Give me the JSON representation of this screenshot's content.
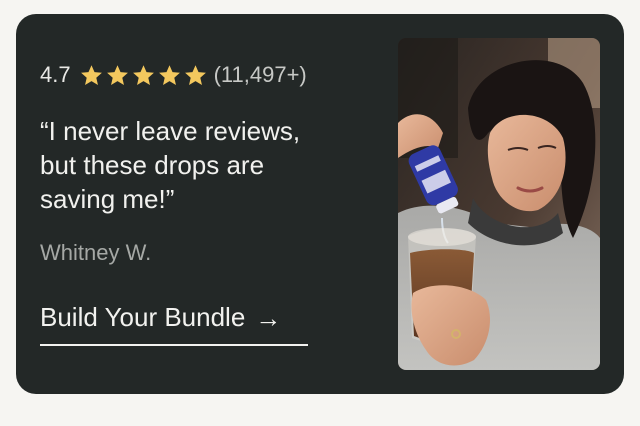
{
  "review": {
    "rating_value": "4.7",
    "stars_count": 5,
    "review_count": "(11,497+)",
    "quote": "“I never leave reviews, but these drops are saving me!”",
    "author": "Whitney W."
  },
  "cta": {
    "label": "Build Your Bundle",
    "arrow": "→"
  },
  "colors": {
    "card_background": "#232827",
    "page_background": "#f6f5f2",
    "star_color": "#f3c85e",
    "text_primary": "#f1f1ee",
    "text_muted": "#a5a8a5"
  },
  "icons": {
    "star": "star-icon",
    "arrow": "arrow-right-icon"
  },
  "photo": {
    "bottle_label": "LIQUID I.V."
  }
}
